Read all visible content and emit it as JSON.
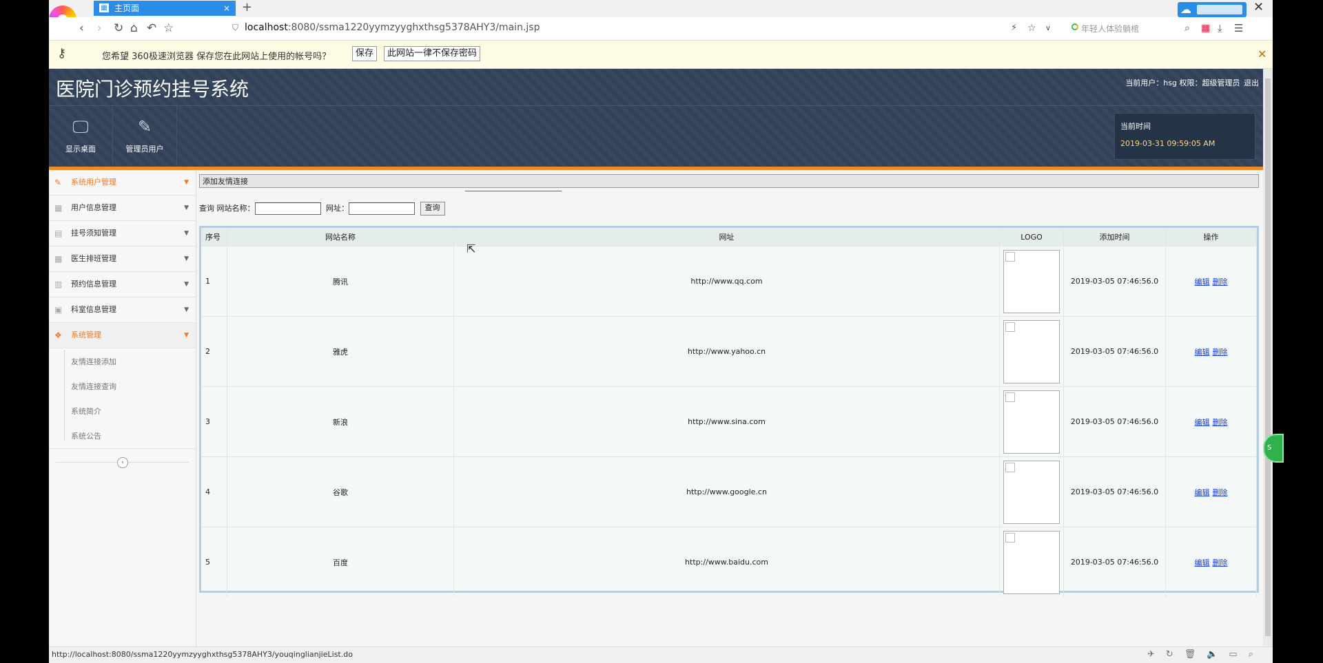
{
  "browser": {
    "tab_title": "主页面",
    "tab_close": "×",
    "new_tab": "+",
    "url_host": "localhost",
    "url_rest": ":8080/ssma1220yymzyyghxthsg5378AHY3/main.jsp",
    "search_hint": "年轻人体验躺棺",
    "window_close": "✕",
    "status_url": "http://localhost:8080/ssma1220yymzyyghxthsg5378AHY3/youqinglianjieList.do"
  },
  "password_bar": {
    "message": "您希望 360极速浏览器 保存您在此网站上使用的帐号吗？",
    "save_label": "保存",
    "never_label": "此网站一律不保存密码",
    "close": "✕"
  },
  "header": {
    "title": "医院门诊预约挂号系统",
    "current_user": "当前用户：hsg 权限：超级管理员",
    "logout": "退出",
    "menu": [
      {
        "label": "显示桌面",
        "icon": "monitor-icon"
      },
      {
        "label": "管理员用户",
        "icon": "pencil-icon"
      }
    ],
    "time_label": "当前时间",
    "time_value": "2019-03-31 09:59:05 AM"
  },
  "sidebar": {
    "items": [
      {
        "label": "系统用户管理",
        "icon": "pencil-icon",
        "active": true
      },
      {
        "label": "用户信息管理",
        "icon": "grid-icon",
        "active": false
      },
      {
        "label": "挂号须知管理",
        "icon": "list-icon",
        "active": false
      },
      {
        "label": "医生排班管理",
        "icon": "grid-icon",
        "active": false
      },
      {
        "label": "预约信息管理",
        "icon": "table-icon",
        "active": false
      },
      {
        "label": "科室信息管理",
        "icon": "calendar-icon",
        "active": false
      },
      {
        "label": "系统管理",
        "icon": "dropbox-icon",
        "active": true
      }
    ],
    "subitems": [
      "友情连接添加",
      "友情连接查询",
      "系统简介",
      "系统公告"
    ]
  },
  "content": {
    "title": "添加友情连接",
    "search": {
      "prefix": "查询",
      "name_label": "网站名称：",
      "url_label": "网址：",
      "name_value": "",
      "url_value": "",
      "button": "查询"
    },
    "table": {
      "headers": [
        "序号",
        "网站名称",
        "网址",
        "LOGO",
        "添加时间",
        "操作"
      ],
      "rows": [
        {
          "idx": "1",
          "name": "腾讯",
          "url": "http://www.qq.com",
          "time": "2019-03-05 07:46:56.0"
        },
        {
          "idx": "2",
          "name": "雅虎",
          "url": "http://www.yahoo.cn",
          "time": "2019-03-05 07:46:56.0"
        },
        {
          "idx": "3",
          "name": "新浪",
          "url": "http://www.sina.com",
          "time": "2019-03-05 07:46:56.0"
        },
        {
          "idx": "4",
          "name": "谷歌",
          "url": "http://www.google.cn",
          "time": "2019-03-05 07:46:56.0"
        },
        {
          "idx": "5",
          "name": "百度",
          "url": "http://www.baidu.com",
          "time": "2019-03-05 07:46:56.0"
        }
      ],
      "edit_label": "编辑",
      "delete_label": "删除"
    }
  },
  "colors": {
    "accent_orange": "#f08a24",
    "header_bg": "#33435a",
    "tab_blue": "#2b8de8"
  }
}
